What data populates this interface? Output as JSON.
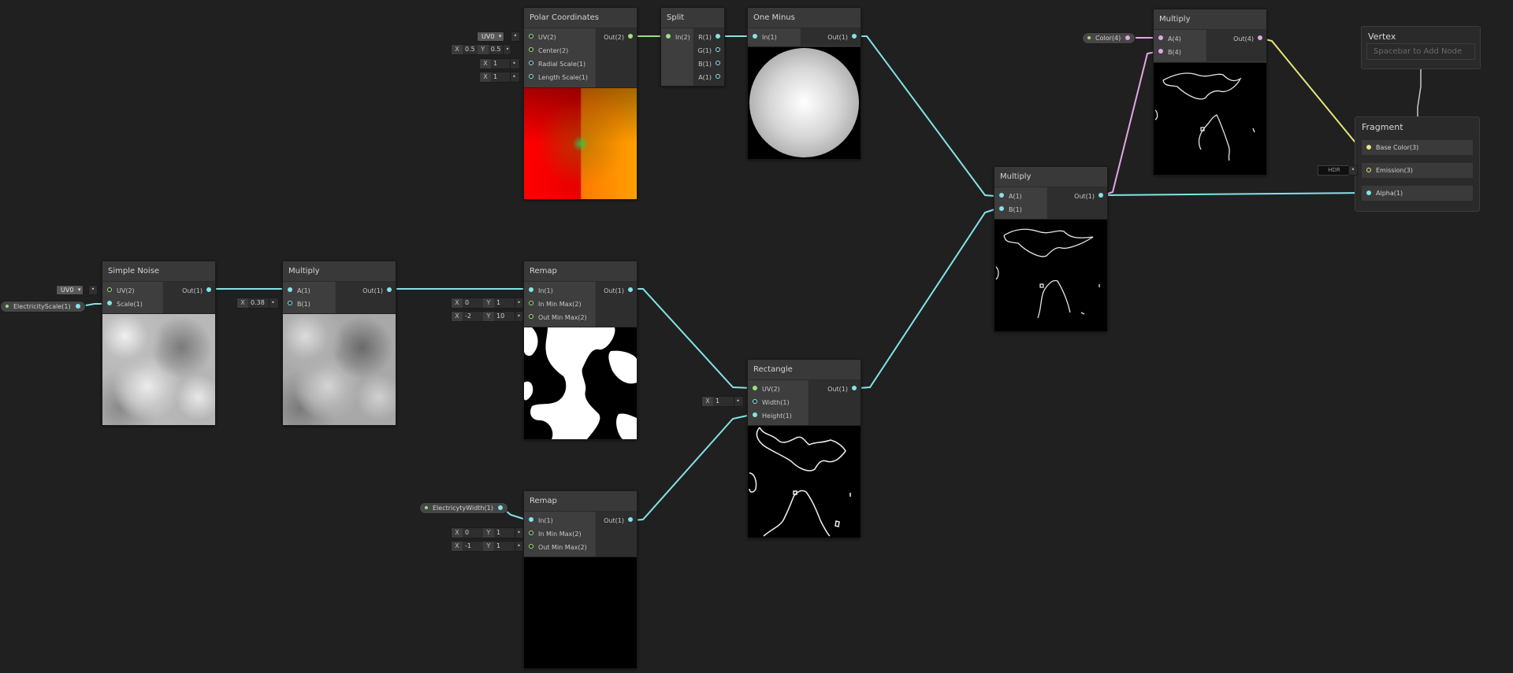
{
  "nodes": {
    "polar": {
      "title": "Polar Coordinates",
      "inputs": [
        "UV(2)",
        "Center(2)",
        "Radial Scale(1)",
        "Length Scale(1)"
      ],
      "output": "Out(2)",
      "uv_channel": "UV0",
      "center_x": "0.5",
      "center_y": "0.5",
      "radial_scale": "1",
      "length_scale": "1"
    },
    "split": {
      "title": "Split",
      "inputs": [
        "In(2)"
      ],
      "outputs": [
        "R(1)",
        "G(1)",
        "B(1)",
        "A(1)"
      ]
    },
    "one_minus": {
      "title": "One Minus",
      "inputs": [
        "In(1)"
      ],
      "output": "Out(1)"
    },
    "multiply_top": {
      "title": "Multiply",
      "inputs": [
        "A(4)",
        "B(4)"
      ],
      "output": "Out(4)"
    },
    "multiply_right": {
      "title": "Multiply",
      "inputs": [
        "A(1)",
        "B(1)"
      ],
      "output": "Out(1)"
    },
    "simple_noise": {
      "title": "Simple Noise",
      "inputs": [
        "UV(2)",
        "Scale(1)"
      ],
      "output": "Out(1)",
      "uv_channel": "UV0"
    },
    "multiply_left": {
      "title": "Multiply",
      "inputs": [
        "A(1)",
        "B(1)"
      ],
      "output": "Out(1)",
      "b_value": "0.38"
    },
    "remap_top": {
      "title": "Remap",
      "inputs": [
        "In(1)",
        "In Min Max(2)",
        "Out Min Max(2)"
      ],
      "output": "Out(1)",
      "in_min": "0",
      "in_max": "1",
      "out_min": "-2",
      "out_max": "10"
    },
    "rectangle": {
      "title": "Rectangle",
      "inputs": [
        "UV(2)",
        "Width(1)",
        "Height(1)"
      ],
      "output": "Out(1)",
      "width_value": "1"
    },
    "remap_bottom": {
      "title": "Remap",
      "inputs": [
        "In(1)",
        "In Min Max(2)",
        "Out Min Max(2)"
      ],
      "output": "Out(1)",
      "in_min": "0",
      "in_max": "1",
      "out_min": "-1",
      "out_max": "1"
    }
  },
  "properties": {
    "color": "Color(4)",
    "electricity_scale": "ElectricityScale(1)",
    "electricity_width": "ElectricytyWidth(1)"
  },
  "master": {
    "vertex_title": "Vertex",
    "vertex_hint": "Spacebar to Add Node",
    "fragment_title": "Fragment",
    "slots": [
      "Base Color(3)",
      "Emission(3)",
      "Alpha(1)"
    ],
    "hdr_label": "HDR"
  },
  "field_labels": {
    "x": "X",
    "y": "Y",
    "link": "•"
  },
  "colors": {
    "background": "#202020",
    "wire_float": "#84e4e7",
    "wire_vector2": "#9ee080",
    "wire_vector4": "#e2a6e5",
    "wire_vector3": "#e9e67a"
  }
}
